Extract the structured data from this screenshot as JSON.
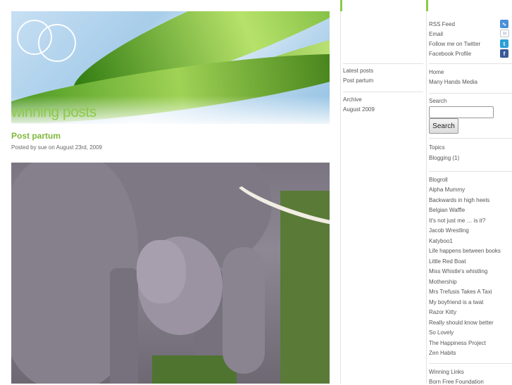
{
  "header": {
    "title": "winning posts"
  },
  "post": {
    "title": "Post partum",
    "meta": "Posted by sue on August 23rd, 2009"
  },
  "middle": {
    "latest_heading": "Latest posts",
    "latest_item": "Post partum",
    "archive_heading": "Archive",
    "archive_item": "August 2009"
  },
  "sidebar": {
    "social": [
      {
        "label": "RSS Feed",
        "icon": "rss-icon",
        "color": "#3b7fc9"
      },
      {
        "label": "Email",
        "icon": "email-icon",
        "color": "#aab3c4"
      },
      {
        "label": "Follow me on Twitter",
        "icon": "twitter-icon",
        "color": "#2a9fd6"
      },
      {
        "label": "Facebook Profile",
        "icon": "facebook-icon",
        "color": "#3b5998"
      }
    ],
    "nav": [
      "Home",
      "Many Hands Media"
    ],
    "search": {
      "heading": "Search",
      "button": "Search",
      "value": ""
    },
    "topics": {
      "heading": "Topics",
      "item": "Blogging (1)"
    },
    "blogroll": {
      "heading": "Blogroll",
      "items": [
        "Alpha Mummy",
        "Backwards in high heels",
        "Belgian Waffle",
        "It's not just me … is it?",
        "Jacob Wrestling",
        "Katyboo1",
        "Life happens between books",
        "Little Red Boat",
        "Miss Whistle's whistling",
        "Mothership",
        "Mrs Trefusis Takes A Taxi",
        "My boyfriend is a twat",
        "Razor Kitty",
        "Really should know better",
        "So Lovely",
        "The Happiness Project",
        "Zen Habits"
      ]
    },
    "winning_links": {
      "heading": "Winning Links",
      "items": [
        "Born Free Foundation"
      ]
    }
  },
  "colors": {
    "accent_green": "#8cc94a",
    "link_blue": "#2a6fbf"
  }
}
